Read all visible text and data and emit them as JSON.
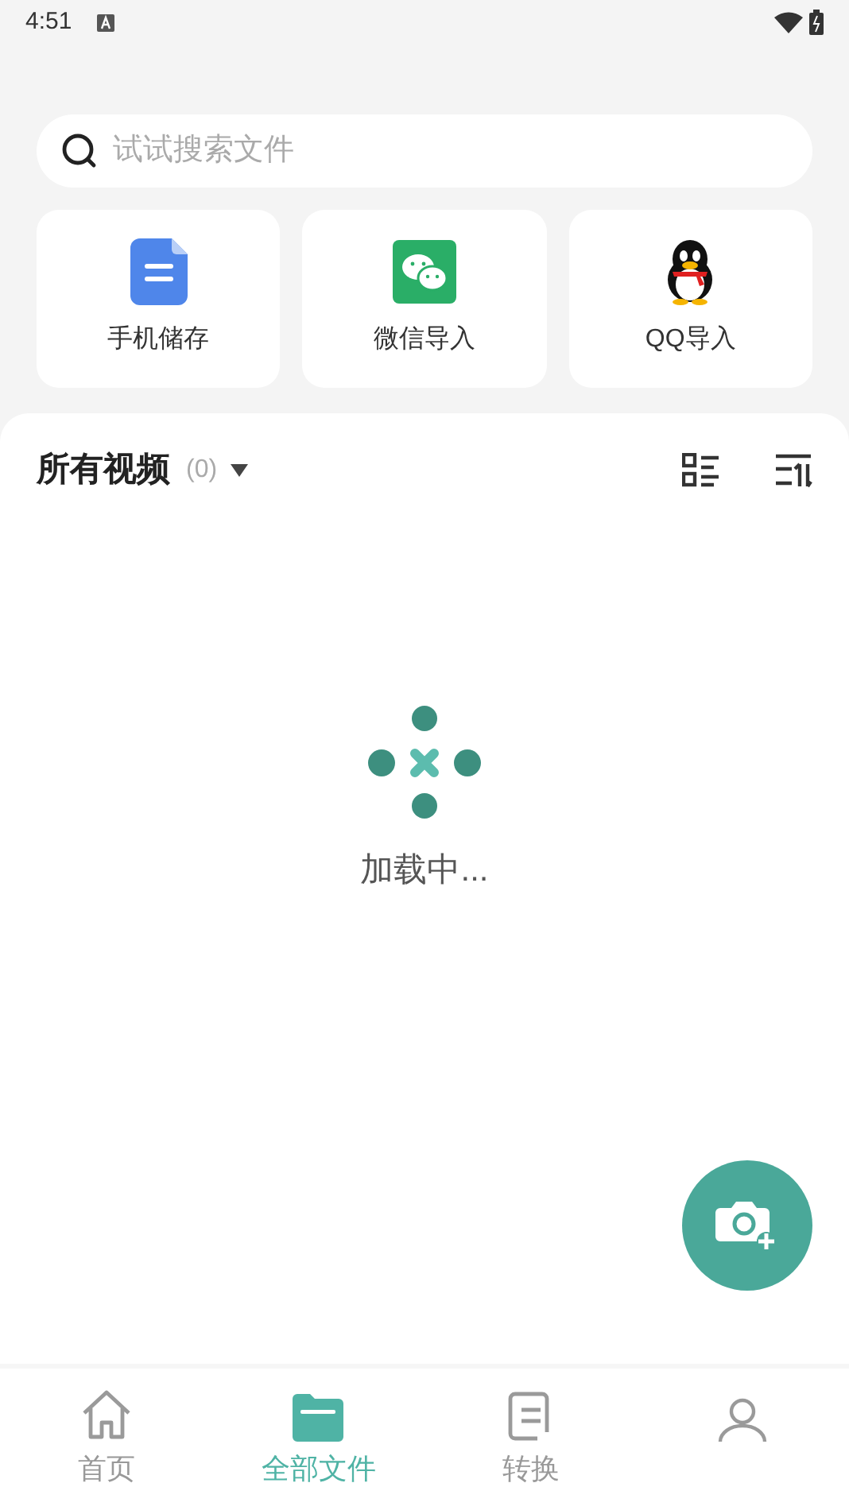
{
  "status_bar": {
    "time": "4:51"
  },
  "search": {
    "placeholder": "试试搜索文件"
  },
  "sources": [
    {
      "kind": "storage",
      "label": "手机储存"
    },
    {
      "kind": "wechat",
      "label": "微信导入"
    },
    {
      "kind": "qq",
      "label": "QQ导入"
    }
  ],
  "section": {
    "title": "所有视频",
    "count": "(0)"
  },
  "loading": {
    "text": "加载中..."
  },
  "nav": [
    {
      "kind": "home",
      "label": "首页",
      "selected": false
    },
    {
      "kind": "folder",
      "label": "全部文件",
      "selected": true
    },
    {
      "kind": "convert",
      "label": "转换",
      "selected": false
    },
    {
      "kind": "person",
      "selected": false
    }
  ]
}
